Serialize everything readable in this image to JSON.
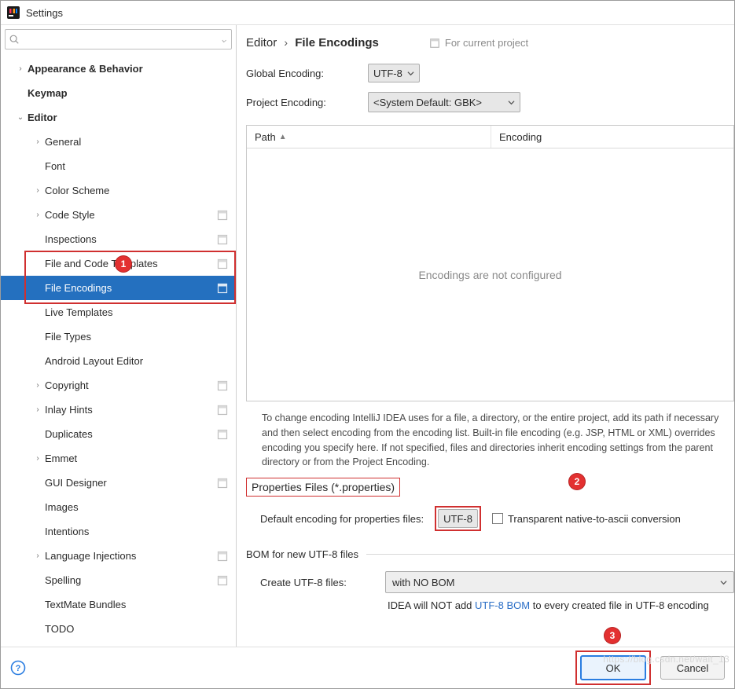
{
  "window": {
    "title": "Settings"
  },
  "search": {
    "placeholder": ""
  },
  "sidebar": {
    "items": [
      {
        "label": "Appearance & Behavior",
        "expander": "›",
        "bold": true,
        "level": 1
      },
      {
        "label": "Keymap",
        "expander": "",
        "bold": true,
        "level": 1
      },
      {
        "label": "Editor",
        "expander": "⌄",
        "bold": true,
        "level": 1
      },
      {
        "label": "General",
        "expander": "›",
        "level": 2
      },
      {
        "label": "Font",
        "expander": "",
        "level": 2
      },
      {
        "label": "Color Scheme",
        "expander": "›",
        "level": 2
      },
      {
        "label": "Code Style",
        "expander": "›",
        "level": 2,
        "proj": true
      },
      {
        "label": "Inspections",
        "expander": "",
        "level": 2,
        "proj": true
      },
      {
        "label": "File and Code Templates",
        "expander": "",
        "level": 2,
        "proj": true
      },
      {
        "label": "File Encodings",
        "expander": "",
        "level": 2,
        "proj": true,
        "selected": true
      },
      {
        "label": "Live Templates",
        "expander": "",
        "level": 2
      },
      {
        "label": "File Types",
        "expander": "",
        "level": 2
      },
      {
        "label": "Android Layout Editor",
        "expander": "",
        "level": 2
      },
      {
        "label": "Copyright",
        "expander": "›",
        "level": 2,
        "proj": true
      },
      {
        "label": "Inlay Hints",
        "expander": "›",
        "level": 2,
        "proj": true
      },
      {
        "label": "Duplicates",
        "expander": "",
        "level": 2,
        "proj": true
      },
      {
        "label": "Emmet",
        "expander": "›",
        "level": 2
      },
      {
        "label": "GUI Designer",
        "expander": "",
        "level": 2,
        "proj": true
      },
      {
        "label": "Images",
        "expander": "",
        "level": 2
      },
      {
        "label": "Intentions",
        "expander": "",
        "level": 2
      },
      {
        "label": "Language Injections",
        "expander": "›",
        "level": 2,
        "proj": true
      },
      {
        "label": "Spelling",
        "expander": "",
        "level": 2,
        "proj": true
      },
      {
        "label": "TextMate Bundles",
        "expander": "",
        "level": 2
      },
      {
        "label": "TODO",
        "expander": "",
        "level": 2
      }
    ]
  },
  "breadcrumb": {
    "root": "Editor",
    "leaf": "File Encodings"
  },
  "forProject": "For current project",
  "global": {
    "label": "Global Encoding:",
    "value": "UTF-8"
  },
  "project": {
    "label": "Project Encoding:",
    "value": "<System Default: GBK>"
  },
  "table": {
    "colPath": "Path",
    "colEncoding": "Encoding",
    "empty": "Encodings are not configured"
  },
  "help": "To change encoding IntelliJ IDEA uses for a file, a directory, or the entire project, add its path if necessary and then select encoding from the encoding list. Built-in file encoding (e.g. JSP, HTML or XML) overrides encoding you specify here. If not specified, files and directories inherit encoding settings from the parent directory or from the Project Encoding.",
  "props": {
    "section": "Properties Files (*.properties)",
    "label": "Default encoding for properties files:",
    "value": "UTF-8",
    "transparent": "Transparent native-to-ascii conversion"
  },
  "bom": {
    "section": "BOM for new UTF-8 files",
    "label": "Create UTF-8 files:",
    "value": "with NO BOM",
    "notePrefix": "IDEA will NOT add ",
    "noteLink": "UTF-8 BOM",
    "noteSuffix": " to every created file in UTF-8 encoding"
  },
  "footer": {
    "ok": "OK",
    "cancel": "Cancel"
  },
  "callouts": {
    "c1": "1",
    "c2": "2",
    "c3": "3"
  },
  "watermark": "https://blog.csdn.net/wait_13"
}
